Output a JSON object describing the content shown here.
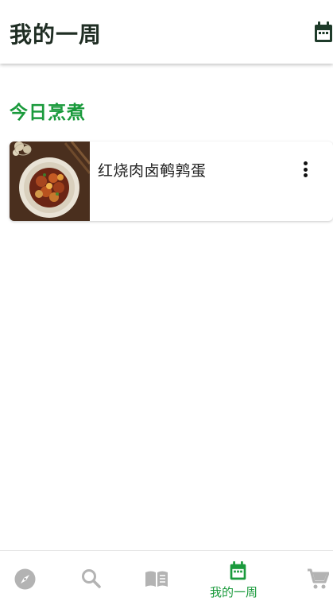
{
  "header": {
    "title": "我的一周",
    "calendar_icon": "calendar-icon"
  },
  "section": {
    "title": "今日烹煮"
  },
  "recipes": [
    {
      "title": "红烧肉卤鹌鹑蛋",
      "image": "braised-pork-quail-eggs-photo",
      "menu_icon": "more-vertical-icon"
    }
  ],
  "bottom_nav": {
    "items": [
      {
        "icon": "compass-icon",
        "label": "",
        "active": false
      },
      {
        "icon": "search-icon",
        "label": "",
        "active": false
      },
      {
        "icon": "book-icon",
        "label": "",
        "active": false
      },
      {
        "icon": "calendar-icon",
        "label": "我的一周",
        "active": true
      },
      {
        "icon": "cart-icon",
        "label": "",
        "active": false
      }
    ]
  },
  "colors": {
    "accent": "#1a9a3c",
    "title_text": "#1f2d23",
    "inactive_icon": "#b3b3b3",
    "header_icon": "#1e3b2a"
  }
}
